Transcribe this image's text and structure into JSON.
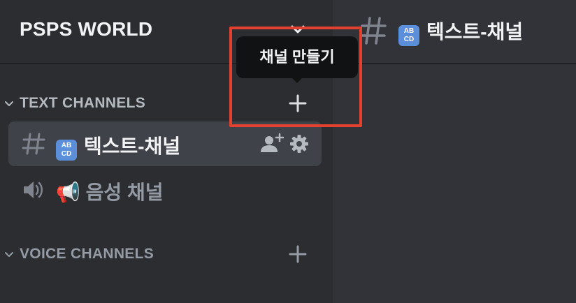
{
  "server": {
    "name": "PSPS WORLD"
  },
  "header": {
    "channel_emoji": [
      "AB",
      "CD"
    ],
    "channel_name": "텍스트-채널"
  },
  "categories": [
    {
      "label": "TEXT CHANNELS"
    },
    {
      "label": "VOICE CHANNELS"
    }
  ],
  "channels": [
    {
      "emoji": [
        "AB",
        "CD"
      ],
      "name": "텍스트-채널",
      "type": "text",
      "selected": true
    },
    {
      "emoji": "📢",
      "name": "음성 채널",
      "type": "voice",
      "selected": false
    }
  ],
  "tooltip": {
    "text": "채널 만들기"
  },
  "icons": {
    "server_chevron": "chevron-down-icon",
    "main_hash": "hashtag-icon",
    "category_chevron": "chevron-down-icon",
    "category_add": "plus-icon",
    "text_channel": "hashtag-icon",
    "voice_channel": "speaker-icon",
    "invite": "add-user-icon",
    "settings": "gear-icon"
  },
  "colors": {
    "sidebar_bg": "#2b2d31",
    "main_bg": "#313338",
    "selected_channel_bg": "#404249",
    "tooltip_bg": "#111214",
    "highlight": "#e4402f",
    "emoji_badge": "#5b8fd9"
  }
}
